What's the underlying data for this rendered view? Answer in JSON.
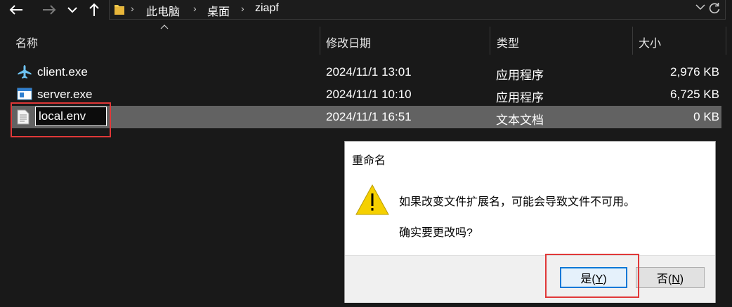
{
  "breadcrumbs": [
    "此电脑",
    "桌面",
    "ziapf"
  ],
  "columns": {
    "name": "名称",
    "modified": "修改日期",
    "type": "类型",
    "size": "大小"
  },
  "files": [
    {
      "name": "client.exe",
      "modified": "2024/11/1 13:01",
      "type": "应用程序",
      "size": "2,976 KB",
      "icon": "airplane-icon"
    },
    {
      "name": "server.exe",
      "modified": "2024/11/1 10:10",
      "type": "应用程序",
      "size": "6,725 KB",
      "icon": "app-window-icon"
    },
    {
      "name": "local.env",
      "modified": "2024/11/1 16:51",
      "type": "文本文档",
      "size": "0 KB",
      "icon": "text-file-icon",
      "renaming": true
    }
  ],
  "dialog": {
    "title": "重命名",
    "message": "如果改变文件扩展名，可能会导致文件不可用。",
    "question": "确实要更改吗?",
    "yes_label": "是(Y)",
    "yes_text": "是(",
    "yes_key": "Y",
    "no_text": "否(",
    "no_key": "N",
    "close_paren": ")"
  },
  "colors": {
    "background": "#191919",
    "selected_row": "#626262",
    "highlight_red": "#e03838",
    "default_button_border": "#0078d7",
    "warning_yellow": "#f5d000"
  }
}
